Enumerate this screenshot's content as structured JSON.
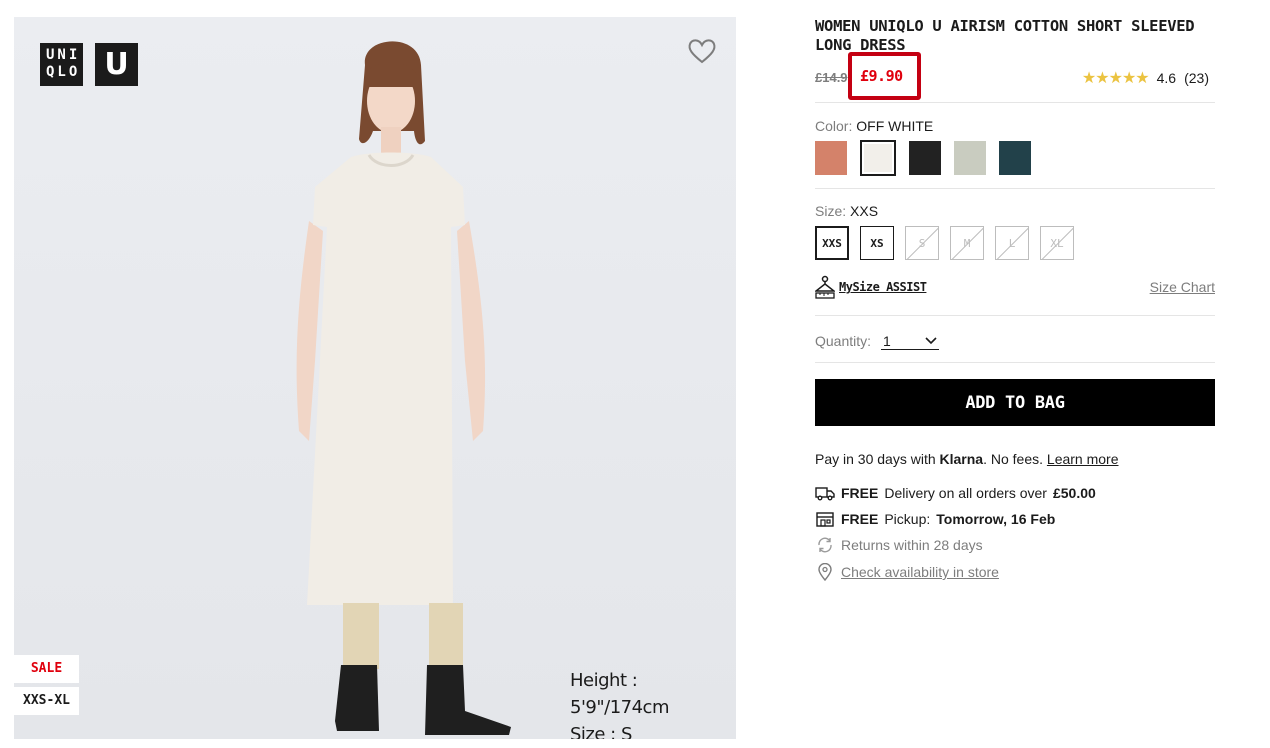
{
  "product": {
    "title": "WOMEN UNIQLO U AIRISM COTTON SHORT SLEEVED LONG DRESS",
    "old_price": "£14.9",
    "sale_price": "£9.90",
    "stars": "★★★★★",
    "rating": "4.6",
    "review_count": "(23)"
  },
  "gallery": {
    "logo_uniqlo": "UNI QLO",
    "logo_u": "U",
    "caption_height": "Height : 5'9\"/174cm",
    "caption_size": "Size : S",
    "tag_sale": "SALE",
    "tag_range": "XXS-XL"
  },
  "color": {
    "label": "Color:",
    "selected": "OFF WHITE",
    "swatches": [
      {
        "name": "terracotta",
        "hex": "#d4826a"
      },
      {
        "name": "off-white",
        "hex": "#f2efea"
      },
      {
        "name": "black",
        "hex": "#222222"
      },
      {
        "name": "light-sage",
        "hex": "#c9ccc0"
      },
      {
        "name": "dark-teal",
        "hex": "#22414a"
      }
    ]
  },
  "size": {
    "label": "Size:",
    "selected": "XXS",
    "options": [
      {
        "label": "XXS",
        "state": "selected"
      },
      {
        "label": "XS",
        "state": "available"
      },
      {
        "label": "S",
        "state": "unavailable"
      },
      {
        "label": "M",
        "state": "unavailable"
      },
      {
        "label": "L",
        "state": "unavailable"
      },
      {
        "label": "XL",
        "state": "unavailable"
      }
    ],
    "mysize_label": "MySize ASSIST",
    "size_chart_label": "Size Chart"
  },
  "quantity": {
    "label": "Quantity:",
    "value": "1"
  },
  "actions": {
    "add_to_bag": "ADD TO BAG"
  },
  "klarna": {
    "prefix": "Pay in 30 days with",
    "brand": "Klarna",
    "suffix": ". No fees.",
    "link": "Learn more"
  },
  "delivery": {
    "free": "FREE",
    "text": "Delivery on all orders over",
    "threshold": "£50.00"
  },
  "pickup": {
    "free": "FREE",
    "text": "Pickup:",
    "date": "Tomorrow, 16 Feb"
  },
  "returns": {
    "text": "Returns within 28 days"
  },
  "store": {
    "link": "Check availability in store"
  },
  "colors": {
    "sale_red": "#e0000d",
    "highlight_box": "#c40012",
    "star_gold": "#ebc341"
  }
}
